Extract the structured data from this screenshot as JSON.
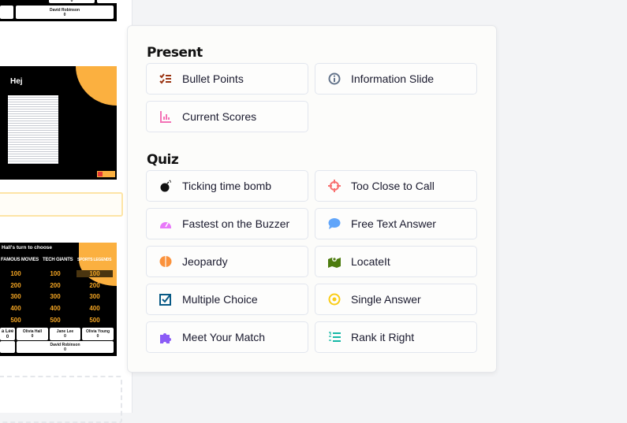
{
  "present": {
    "heading": "Present",
    "items": [
      {
        "label": "Bullet Points",
        "icon": "checklist-icon",
        "color": "#9a3412"
      },
      {
        "label": "Information Slide",
        "icon": "info-icon",
        "color": "#64748b"
      },
      {
        "label": "Current Scores",
        "icon": "bar-chart-icon",
        "color": "#f472b6"
      }
    ]
  },
  "quiz": {
    "heading": "Quiz",
    "items": [
      {
        "label": "Ticking time bomb",
        "icon": "bomb-icon",
        "color": "#111111"
      },
      {
        "label": "Too Close to Call",
        "icon": "crosshair-icon",
        "color": "#f87171"
      },
      {
        "label": "Fastest on the Buzzer",
        "icon": "speedometer-icon",
        "color": "#e879f9"
      },
      {
        "label": "Free Text Answer",
        "icon": "chat-bubble-icon",
        "color": "#60a5fa"
      },
      {
        "label": "Jeopardy",
        "icon": "brain-icon",
        "color": "#fb923c"
      },
      {
        "label": "LocateIt",
        "icon": "map-pin-icon",
        "color": "#4d7c0f"
      },
      {
        "label": "Multiple Choice",
        "icon": "checkbox-icon",
        "color": "#075985"
      },
      {
        "label": "Single Answer",
        "icon": "radio-icon",
        "color": "#facc15"
      },
      {
        "label": "Meet Your Match",
        "icon": "puzzle-icon",
        "color": "#8b5cf6"
      },
      {
        "label": "Rank it Right",
        "icon": "numbered-list-icon",
        "color": "#14b8a6"
      }
    ]
  },
  "slides": {
    "top": {
      "player": "David Robinson",
      "score": "0",
      "zeros": [
        "0",
        "0",
        "0"
      ]
    },
    "info": {
      "title": "Hej"
    },
    "jeopardy": {
      "turn": "Hall's turn to choose",
      "categories": [
        "FAMOUS MOVIES",
        "TECH GIANTS",
        "SPORTS LEGENDS"
      ],
      "values": [
        "100",
        "200",
        "300",
        "400",
        "500"
      ],
      "players": [
        {
          "name": "a Lee",
          "score": "0"
        },
        {
          "name": "Olivia Hall",
          "score": "0"
        },
        {
          "name": "Jane Lee",
          "score": "0"
        },
        {
          "name": "Olivia Young",
          "score": "0"
        }
      ],
      "bottom_player": {
        "name": "David Robinson",
        "score": "0"
      }
    }
  }
}
